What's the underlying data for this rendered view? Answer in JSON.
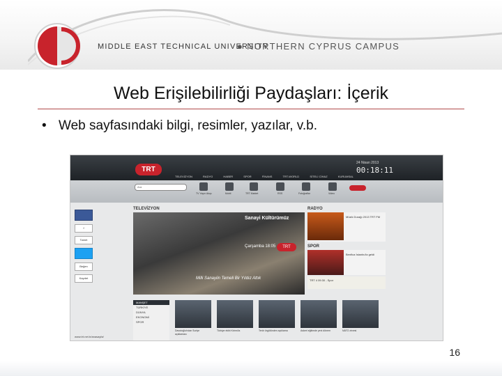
{
  "header": {
    "university": "MIDDLE EAST TECHNICAL UNIVERSITY",
    "campus": "● NORTHERN CYPRUS CAMPUS"
  },
  "slide": {
    "title": "Web Erişilebilirliği Paydaşları: İçerik",
    "bullet": "Web sayfasındaki bilgi, resimler, yazılar, v.b.",
    "page_number": "16"
  },
  "screenshot": {
    "logo": "TRT",
    "nav": [
      "TELEVİZYON",
      "RADYO",
      "HABER",
      "SPOR",
      "FİNANS",
      "TRT-WORLD",
      "SİTELİ CİHAZ",
      "KURUMSAL"
    ],
    "date": "24 Nisan 2013",
    "clock": "00:18:11",
    "search_placeholder": "Ara",
    "toolbar_items": [
      "TV Yayın Akışı",
      "Mobil",
      "TRT Market",
      "RSS",
      "Fotoğraflar",
      "Video"
    ],
    "share": [
      "f",
      "Tweet",
      "Beğen",
      "Kaydet"
    ],
    "tv": {
      "label": "TELEVİZYON",
      "overlay_title": "Sanayi Kültürümüz",
      "overlay_time": "Çarşamba 18:05",
      "badge": "TRT",
      "caption": "Milli Sanayiin Temeli Bir Yıldız Attık"
    },
    "radyo": {
      "label": "RADYO",
      "text": "Müzik Durağı 2013 TRT FM"
    },
    "spor": {
      "label": "SPOR",
      "text": "Benfica İstanbul'a geldi"
    },
    "trt4": "TRT 4 09:30 - Spor",
    "news_menu": [
      "MANŞET",
      "TÜRKİYE",
      "DÜNYA",
      "EKONOMİ",
      "SPOR"
    ],
    "news_captions": [
      "Davutoğlu'ndan Suriye açıklaması",
      "Türkiye ekibi Kıbrıs'ta",
      "Terör örgütünden açıklama",
      "Askeri eğitimde yeni dönem",
      "NATO zirvesi"
    ],
    "status_url": "www.trt.net.tr/anasayfa/"
  },
  "colors": {
    "accent_red": "#b04848",
    "trt_red": "#c8232c",
    "trt_dark": "#1e2226"
  }
}
